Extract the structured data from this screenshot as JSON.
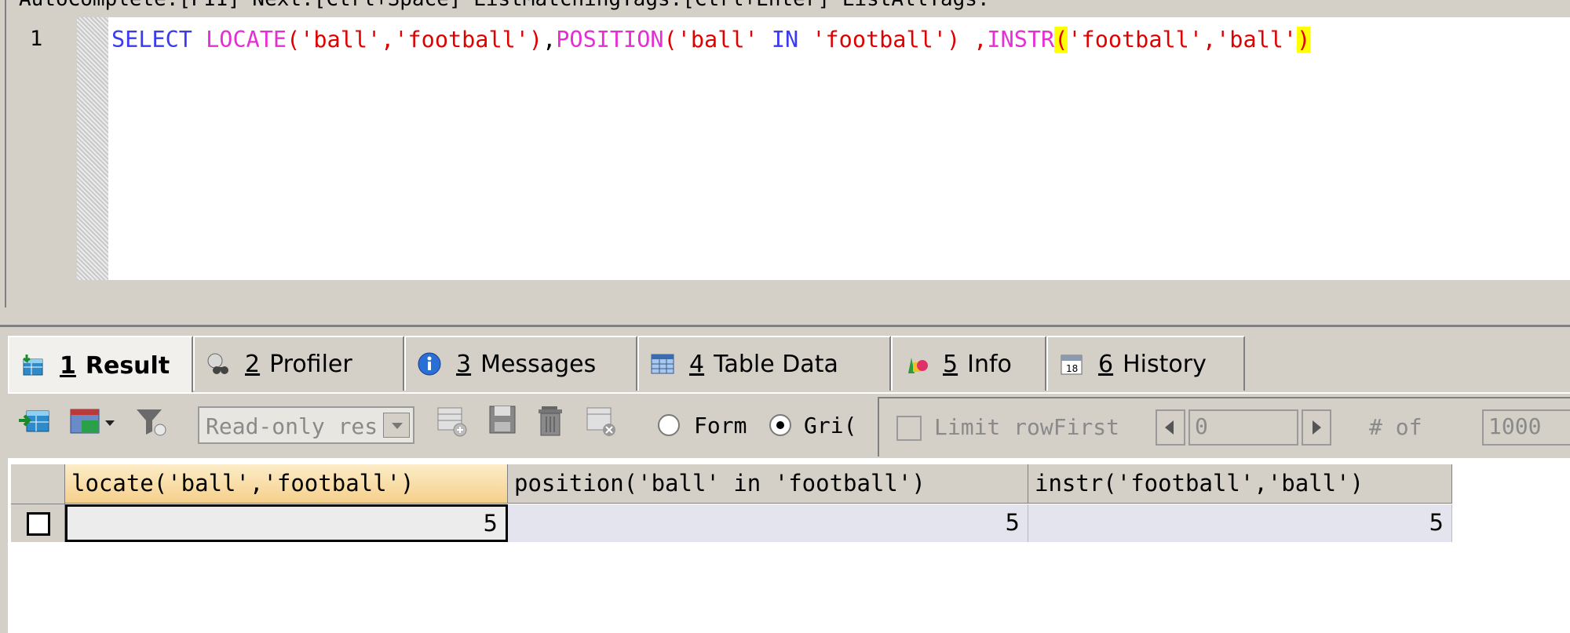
{
  "editor": {
    "line_number": "1",
    "code": {
      "select": "SELECT",
      "locate_fn": "LOCATE",
      "locate_args": "('ball','football')",
      "comma1": ",",
      "position_fn": "POSITION",
      "paren_open": "(",
      "position_str1": "'ball'",
      "in_kw": "IN",
      "position_str2": "'football'",
      "paren_close_comma": ") ,",
      "instr_fn": "INSTR",
      "instr_open": "(",
      "instr_args": "'football','ball'",
      "instr_close": ")"
    }
  },
  "tabs": [
    {
      "num": "1",
      "label": "Result"
    },
    {
      "num": "2",
      "label": "Profiler"
    },
    {
      "num": "3",
      "label": "Messages"
    },
    {
      "num": "4",
      "label": "Table Data"
    },
    {
      "num": "5",
      "label": "Info"
    },
    {
      "num": "6",
      "label": "History"
    }
  ],
  "toolbar": {
    "mode_select": "Read-only res",
    "radio_form": "Form",
    "radio_grid": "Gri(",
    "limit_label": "Limit rowFirst",
    "first_value": "0",
    "of_label": "# of",
    "rows_value": "1000"
  },
  "grid": {
    "columns": [
      "locate('ball','football')",
      "position('ball' in 'football')",
      "instr('football','ball')"
    ],
    "rows": [
      [
        "5",
        "5",
        "5"
      ]
    ]
  },
  "colors": {
    "keyword": "#3a3af0",
    "function": "#e52fd4",
    "string": "#e00000",
    "highlight": "#ffff00"
  }
}
